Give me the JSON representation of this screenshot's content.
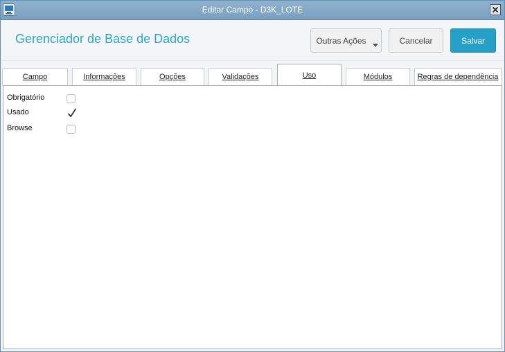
{
  "window": {
    "title": "Editar Campo - D3K_LOTE",
    "app_icon": "monitor-icon",
    "close_icon": "close-icon"
  },
  "header": {
    "app_title": "Gerenciador de Base de Dados",
    "buttons": {
      "more_actions": "Outras Ações",
      "cancel": "Cancelar",
      "save": "Salvar"
    }
  },
  "tabs": [
    {
      "label": "Campo",
      "active": false
    },
    {
      "label": "Informações",
      "active": false
    },
    {
      "label": "Opções",
      "active": false
    },
    {
      "label": "Validações",
      "active": false
    },
    {
      "label": "Uso",
      "active": true
    },
    {
      "label": "Módulos",
      "active": false
    },
    {
      "label": "Regras de dependência",
      "active": false
    }
  ],
  "fields": [
    {
      "label": "Obrigatório",
      "checked": false
    },
    {
      "label": "Usado",
      "checked": true
    },
    {
      "label": "Browse",
      "checked": false
    }
  ],
  "colors": {
    "accent": "#2aa6c6",
    "save_button": "#27a0c8",
    "titlebar": "#7aa0bf"
  }
}
